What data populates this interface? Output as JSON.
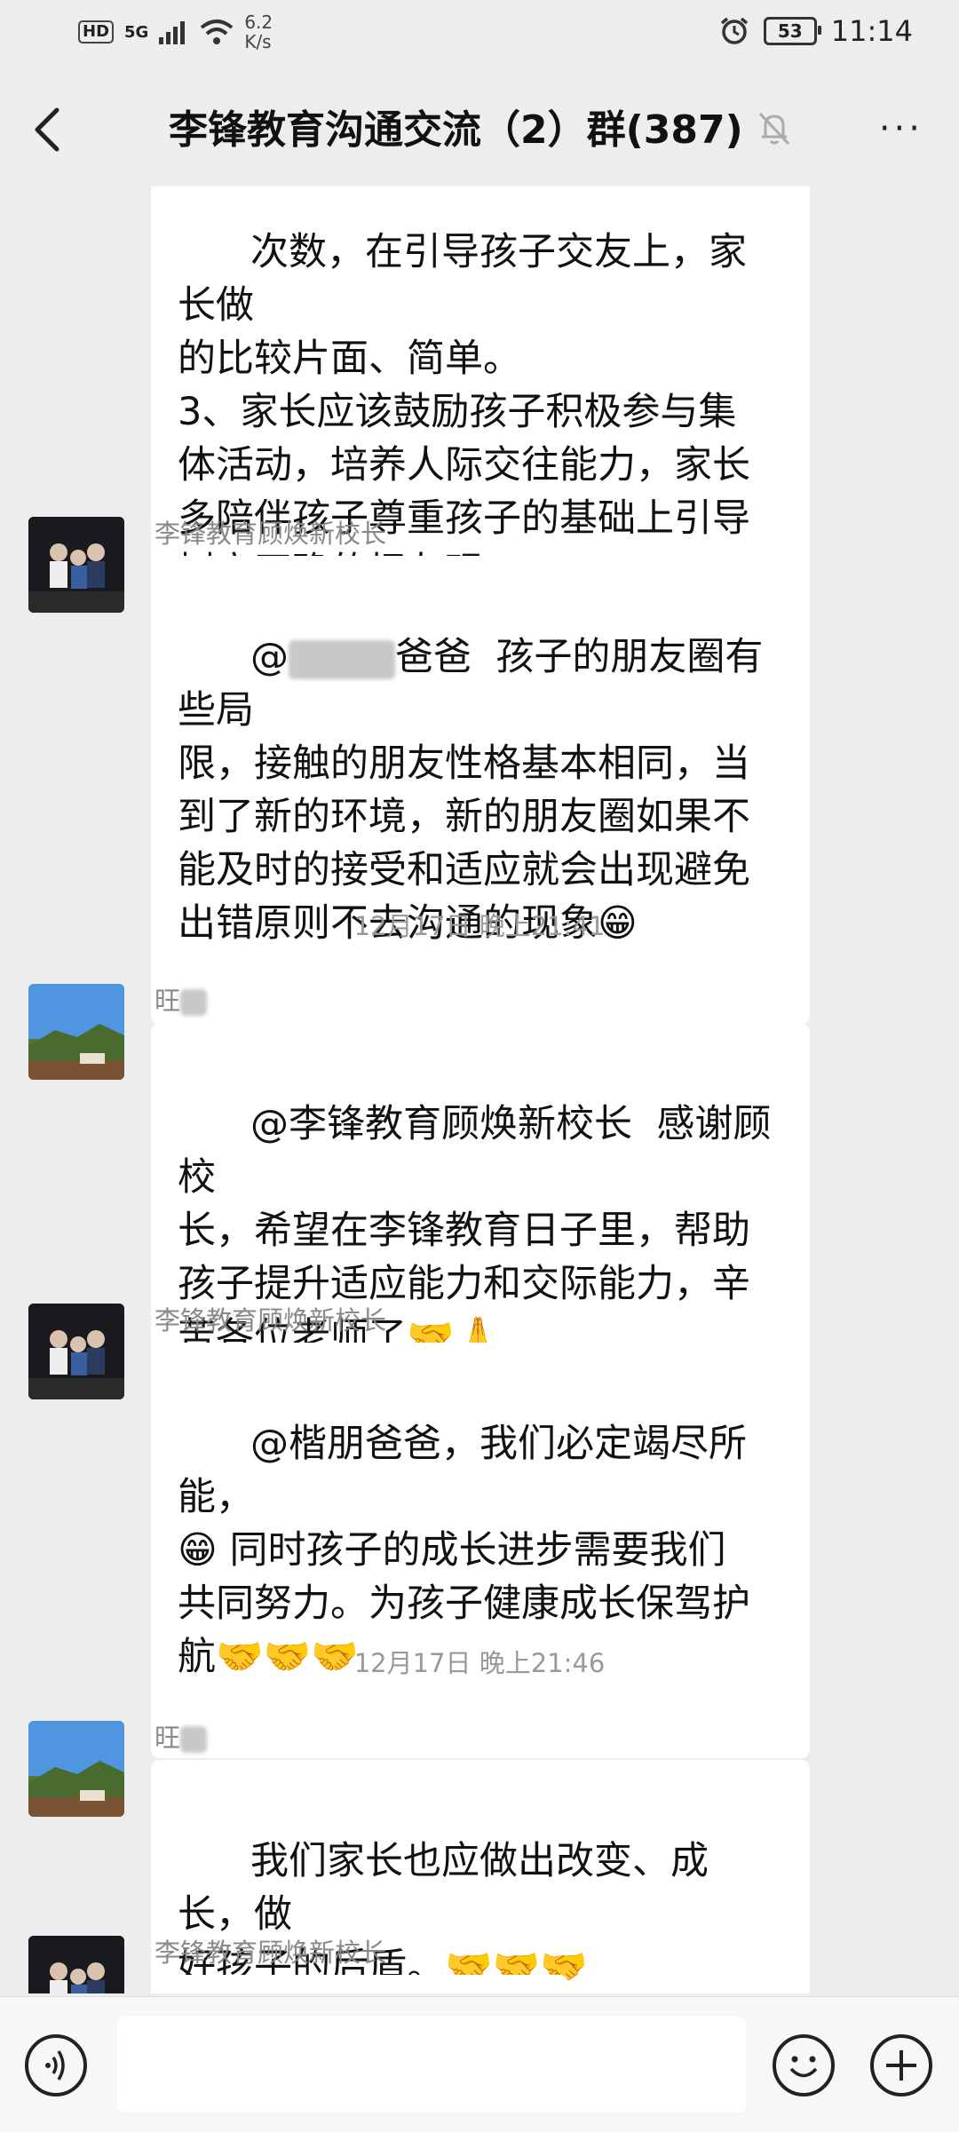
{
  "status_bar": {
    "hd": "HD",
    "network": "5G",
    "speed_value": "6.2",
    "speed_unit": "K/s",
    "battery": "53",
    "time": "11:14"
  },
  "nav": {
    "title": "李锋教育沟通交流（2）群(387)",
    "more": "···"
  },
  "messages": [
    {
      "text": "次数，在引导孩子交友上，家长做\n的比较片面、简单。\n3、家长应该鼓励孩子积极参与集\n体活动，培养人际交往能力，家长\n多陪伴孩子尊重孩子的基础上引导\n树立正确的择友观。"
    },
    {
      "sender": "李锋教育顾焕新校长",
      "text_prefix": "@",
      "text": "爸爸  孩子的朋友圈有些局\n限，接触的朋友性格基本相同，当\n到了新的环境，新的朋友圈如果不\n能及时的接受和适应就会出现避免\n出错原则不去沟通的现象😁"
    },
    {
      "timestamp": "12月17日 晚上21:41"
    },
    {
      "sender": "旺",
      "text": "@李锋教育顾焕新校长  感谢顾校\n长，希望在李锋教育日子里，帮助\n孩子提升适应能力和交际能力，辛\n苦各位老师了🤝🙏"
    },
    {
      "sender": "李锋教育顾焕新校长",
      "text": "@楷朋爸爸，我们必定竭尽所能，\n😁 同时孩子的成长进步需要我们\n共同努力。为孩子健康成长保驾护\n航🤝🤝🤝"
    },
    {
      "timestamp": "12月17日 晚上21:46"
    },
    {
      "sender": "旺",
      "text": "我们家长也应做出改变、成长，做\n好孩子的后盾。🤝🤝🤝"
    },
    {
      "sender": "李锋教育顾焕新校长"
    }
  ],
  "input_bar": {
    "placeholder": ""
  }
}
